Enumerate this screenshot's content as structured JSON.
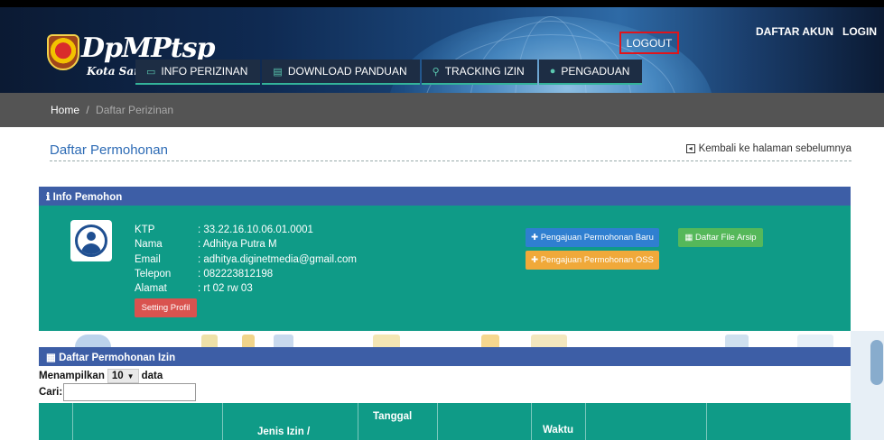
{
  "header": {
    "logo_text": "DpMPtsp",
    "logo_sub": "Kota Sam",
    "top_links": [
      "DAFTAR AKUN",
      "LOGIN"
    ],
    "logout_label": "LOGOUT",
    "nav": [
      {
        "label": "INFO PERIZINAN",
        "icon": "folder-icon"
      },
      {
        "label": "DOWNLOAD PANDUAN",
        "icon": "file-icon"
      },
      {
        "label": "TRACKING IZIN",
        "icon": "search-icon"
      },
      {
        "label": "PENGADUAN",
        "icon": "chat-icon"
      }
    ]
  },
  "breadcrumb": {
    "home": "Home",
    "separator": "/",
    "current": "Daftar Perizinan"
  },
  "page": {
    "title": "Daftar Permohonan",
    "back_label": "Kembali ke halaman sebelumnya"
  },
  "info_pemohon": {
    "heading": "Info Pemohon",
    "fields": [
      {
        "label": "KTP",
        "value": ": 33.22.16.10.06.01.0001"
      },
      {
        "label": "Nama",
        "value": ": Adhitya Putra M"
      },
      {
        "label": "Email",
        "value": ": adhitya.diginetmedia@gmail.com"
      },
      {
        "label": "Telepon",
        "value": ": 082223812198"
      },
      {
        "label": "Alamat",
        "value": ": rt 02 rw 03"
      }
    ],
    "setting_label": "Setting Profil",
    "btn_baru": "Pengajuan Permohonan Baru",
    "btn_oss": "Pengajuan Permohonan OSS",
    "btn_arsip": "Daftar File Arsip"
  },
  "daftar_izin": {
    "heading": "Daftar Permohonan Izin",
    "show_prefix": "Menampilkan",
    "show_value": "10",
    "show_suffix": "data",
    "search_label": "Cari:",
    "search_value": "",
    "columns": [
      "",
      "",
      "Jenis Izin /",
      "Tanggal",
      "",
      "Waktu",
      "",
      ""
    ]
  },
  "colors": {
    "header_blue": "#3d5ea6",
    "teal": "#0f9b87",
    "logout_border": "#e0141b",
    "link_blue": "#2d6bb5"
  }
}
